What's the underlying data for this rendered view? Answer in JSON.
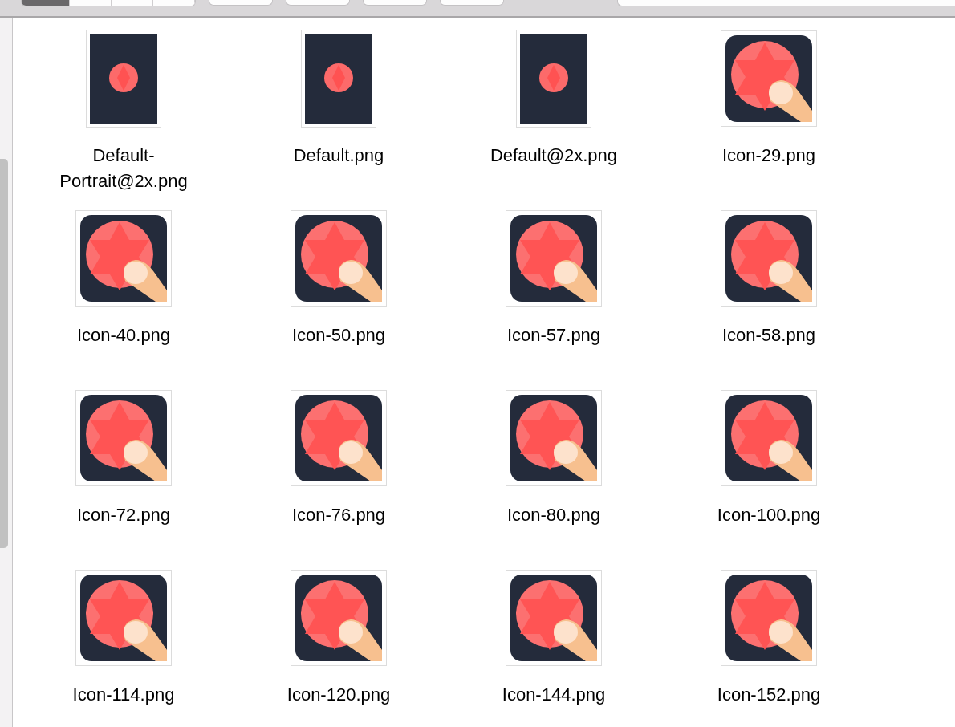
{
  "toolbar": {
    "view_modes": [
      {
        "selected": true
      },
      {
        "selected": false
      },
      {
        "selected": false
      },
      {
        "selected": false
      }
    ]
  },
  "files": [
    {
      "name": "Default-Portrait@2x.png",
      "kind": "portrait"
    },
    {
      "name": "Default.png",
      "kind": "portrait"
    },
    {
      "name": "Default@2x.png",
      "kind": "portrait"
    },
    {
      "name": "Icon-29.png",
      "kind": "icon"
    },
    {
      "name": "Icon-40.png",
      "kind": "icon"
    },
    {
      "name": "Icon-50.png",
      "kind": "icon"
    },
    {
      "name": "Icon-57.png",
      "kind": "icon"
    },
    {
      "name": "Icon-58.png",
      "kind": "icon"
    },
    {
      "name": "Icon-72.png",
      "kind": "icon"
    },
    {
      "name": "Icon-76.png",
      "kind": "icon"
    },
    {
      "name": "Icon-80.png",
      "kind": "icon"
    },
    {
      "name": "Icon-100.png",
      "kind": "icon"
    },
    {
      "name": "Icon-114.png",
      "kind": "icon"
    },
    {
      "name": "Icon-120.png",
      "kind": "icon"
    },
    {
      "name": "Icon-144.png",
      "kind": "icon"
    },
    {
      "name": "Icon-152.png",
      "kind": "icon"
    }
  ]
}
